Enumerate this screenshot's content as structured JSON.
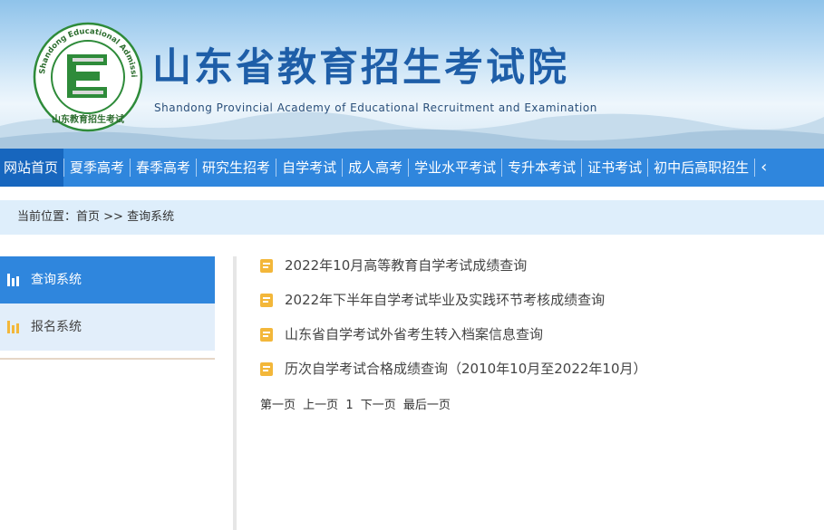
{
  "header": {
    "title": "山东省教育招生考试院",
    "subtitle": "Shandong Provincial Academy of Educational Recruitment and Examination",
    "logo_ring_text": "Shandong Educational Admission & Examinations",
    "logo_bottom_text": "山东教育招生考试",
    "logo_letter": "E"
  },
  "nav": {
    "items": [
      "网站首页",
      "夏季高考",
      "春季高考",
      "研究生招考",
      "自学考试",
      "成人高考",
      "学业水平考试",
      "专升本考试",
      "证书考试",
      "初中后高职招生"
    ],
    "overflow_glyph": "‹"
  },
  "breadcrumb": {
    "label": "当前位置：",
    "home": "首页",
    "sep": " >> ",
    "current": "查询系统"
  },
  "sidebar": {
    "items": [
      {
        "label": "查询系统",
        "icon": "bar-chart-icon"
      },
      {
        "label": "报名系统",
        "icon": "bar-chart-icon"
      }
    ]
  },
  "list": {
    "items": [
      "2022年10月高等教育自学考试成绩查询",
      "2022年下半年自学考试毕业及实践环节考核成绩查询",
      "山东省自学考试外省考生转入档案信息查询",
      "历次自学考试合格成绩查询（2010年10月至2022年10月）"
    ]
  },
  "pager": {
    "first": "第一页",
    "prev": "上一页",
    "current": "1",
    "next": "下一页",
    "last": "最后一页"
  },
  "colors": {
    "nav_bg": "#2f86dd",
    "nav_active": "#1766be",
    "title_blue": "#1e5ea8",
    "logo_green": "#2e8b3a",
    "doc_icon": "#f3b73a"
  }
}
